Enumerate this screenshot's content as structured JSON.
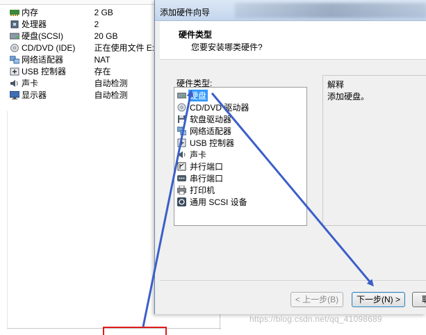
{
  "vm_hardware": {
    "rows": [
      {
        "icon": "memory-icon",
        "name": "内存",
        "summary": "2 GB"
      },
      {
        "icon": "processor-icon",
        "name": "处理器",
        "summary": "2"
      },
      {
        "icon": "hard-disk-icon",
        "name": "硬盘(SCSI)",
        "summary": "20 GB"
      },
      {
        "icon": "cd-dvd-icon",
        "name": "CD/DVD (IDE)",
        "summary": "正在使用文件 E:\\tod"
      },
      {
        "icon": "network-adapter-icon",
        "name": "网络适配器",
        "summary": "NAT"
      },
      {
        "icon": "usb-controller-icon",
        "name": "USB 控制器",
        "summary": "存在"
      },
      {
        "icon": "sound-card-icon",
        "name": "声卡",
        "summary": "自动检测"
      },
      {
        "icon": "display-icon",
        "name": "显示器",
        "summary": "自动检测"
      }
    ]
  },
  "dialog": {
    "title": "添加硬件向导",
    "header_title": "硬件类型",
    "header_subtitle": "您要安装哪类硬件?",
    "list_label": "硬件类型:",
    "hardware_types": [
      {
        "icon": "hard-disk-icon",
        "label": "硬盘",
        "selected": true
      },
      {
        "icon": "cd-dvd-icon",
        "label": "CD/DVD 驱动器",
        "selected": false
      },
      {
        "icon": "floppy-icon",
        "label": "软盘驱动器",
        "selected": false
      },
      {
        "icon": "network-adapter-icon",
        "label": "网络适配器",
        "selected": false
      },
      {
        "icon": "usb-controller-icon",
        "label": "USB 控制器",
        "selected": false
      },
      {
        "icon": "sound-card-icon",
        "label": "声卡",
        "selected": false
      },
      {
        "icon": "parallel-port-icon",
        "label": "并行端口",
        "selected": false
      },
      {
        "icon": "serial-port-icon",
        "label": "串行端口",
        "selected": false
      },
      {
        "icon": "printer-icon",
        "label": "打印机",
        "selected": false
      },
      {
        "icon": "scsi-device-icon",
        "label": "通用 SCSI 设备",
        "selected": false
      }
    ],
    "explain_label": "解释",
    "explain_text": "添加硬盘。",
    "buttons": {
      "back": "< 上一步(B)",
      "next": "下一步(N) >",
      "cancel": "取"
    }
  },
  "watermark": "https://blog.csdn.net/qq_41098689",
  "colors": {
    "selection": "#3399ff",
    "arrow": "#3b5fc9",
    "highlight_box": "#e01b1b"
  }
}
